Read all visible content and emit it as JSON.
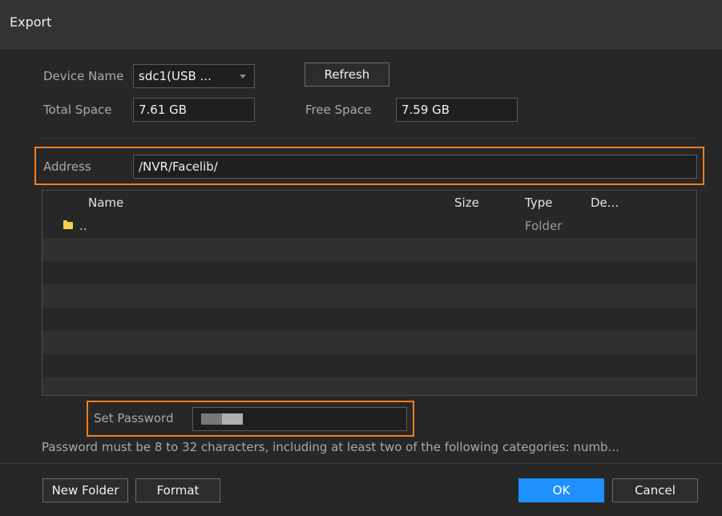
{
  "dialog": {
    "title": "Export"
  },
  "device": {
    "device_name_label": "Device Name",
    "device_name_value": "sdc1(USB ...",
    "refresh_label": "Refresh",
    "total_space_label": "Total Space",
    "total_space_value": "7.61 GB",
    "free_space_label": "Free Space",
    "free_space_value": "7.59 GB"
  },
  "address": {
    "label": "Address",
    "value": "/NVR/Facelib/"
  },
  "table": {
    "columns": {
      "name": "Name",
      "size": "Size",
      "type": "Type",
      "desc": "De..."
    },
    "rows": [
      {
        "name": "..",
        "size": "",
        "type": "Folder",
        "icon": "folder-icon"
      }
    ]
  },
  "password": {
    "label": "Set Password",
    "hint": "Password must be 8 to 32 characters, including at least two of the following categories: numb..."
  },
  "footer": {
    "new_folder_label": "New Folder",
    "format_label": "Format",
    "ok_label": "OK",
    "cancel_label": "Cancel"
  },
  "colors": {
    "accent": "#1e90ff",
    "highlight": "#f07d1f",
    "folder": "#f3d24a"
  }
}
